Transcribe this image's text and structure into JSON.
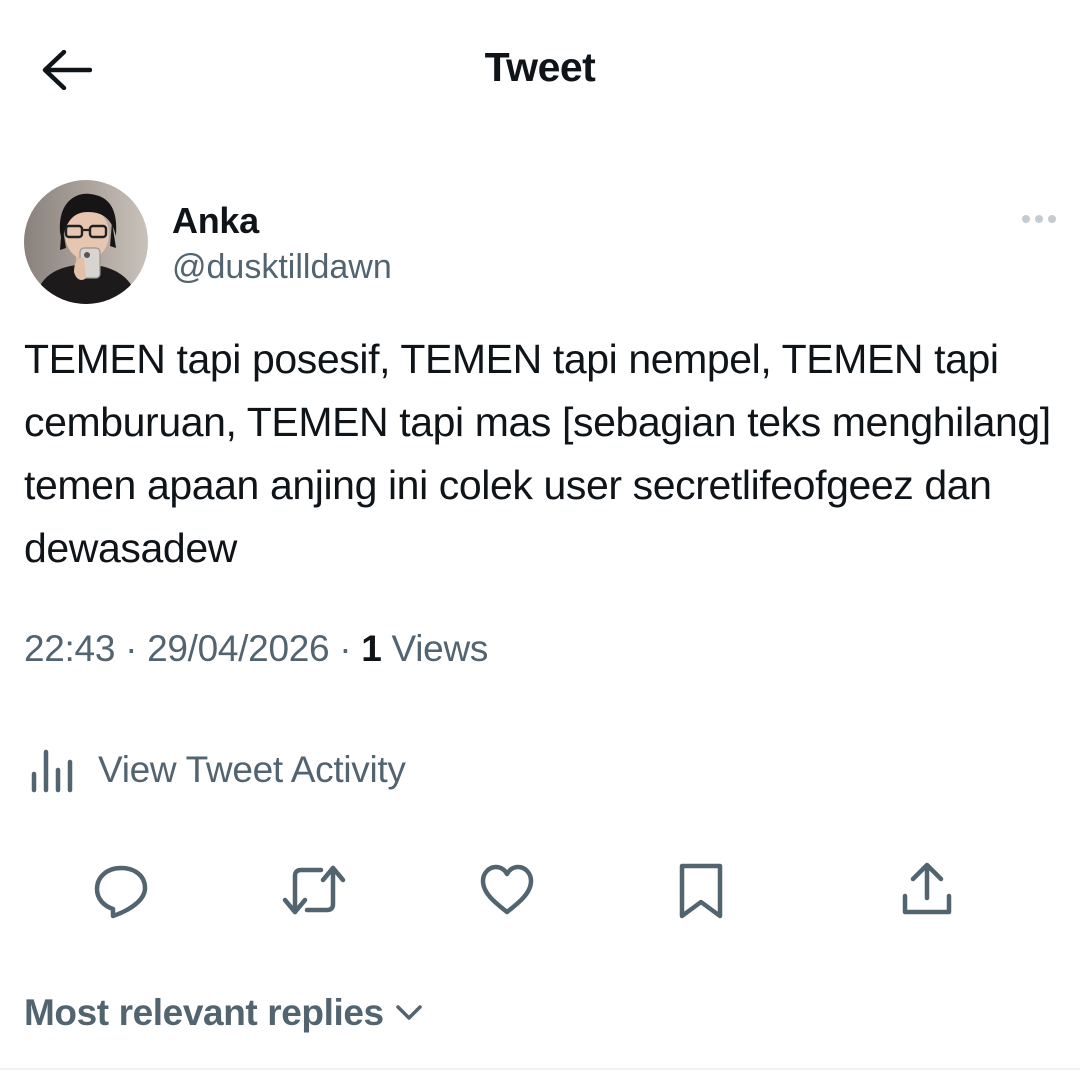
{
  "header": {
    "title": "Tweet",
    "back_icon": "arrow-left-icon"
  },
  "author": {
    "name": "Anka",
    "handle": "@dusktilldawn",
    "avatar_icon": "profile-photo"
  },
  "tweet": {
    "text": "TEMEN tapi posesif, TEMEN tapi nempel, TEMEN tapi cemburuan, TEMEN tapi mas [sebagian teks menghilang] temen apaan anjing ini colek user secretlifeofgeez dan dewasadew",
    "time": "22:43",
    "separator": "·",
    "date": "29/04/2026",
    "views_count": "1",
    "views_label": "Views"
  },
  "activity": {
    "label": "View Tweet Activity",
    "icon": "analytics-icon"
  },
  "actions": [
    {
      "name": "reply",
      "icon": "reply-icon"
    },
    {
      "name": "retweet",
      "icon": "retweet-icon"
    },
    {
      "name": "like",
      "icon": "heart-icon"
    },
    {
      "name": "bookmark",
      "icon": "bookmark-icon"
    },
    {
      "name": "share",
      "icon": "share-icon"
    }
  ],
  "replies": {
    "sort_label": "Most relevant replies"
  },
  "colors": {
    "text_primary": "#0f1419",
    "text_secondary": "#536471",
    "icon_gray": "#536471",
    "divider": "#eff3f4"
  }
}
